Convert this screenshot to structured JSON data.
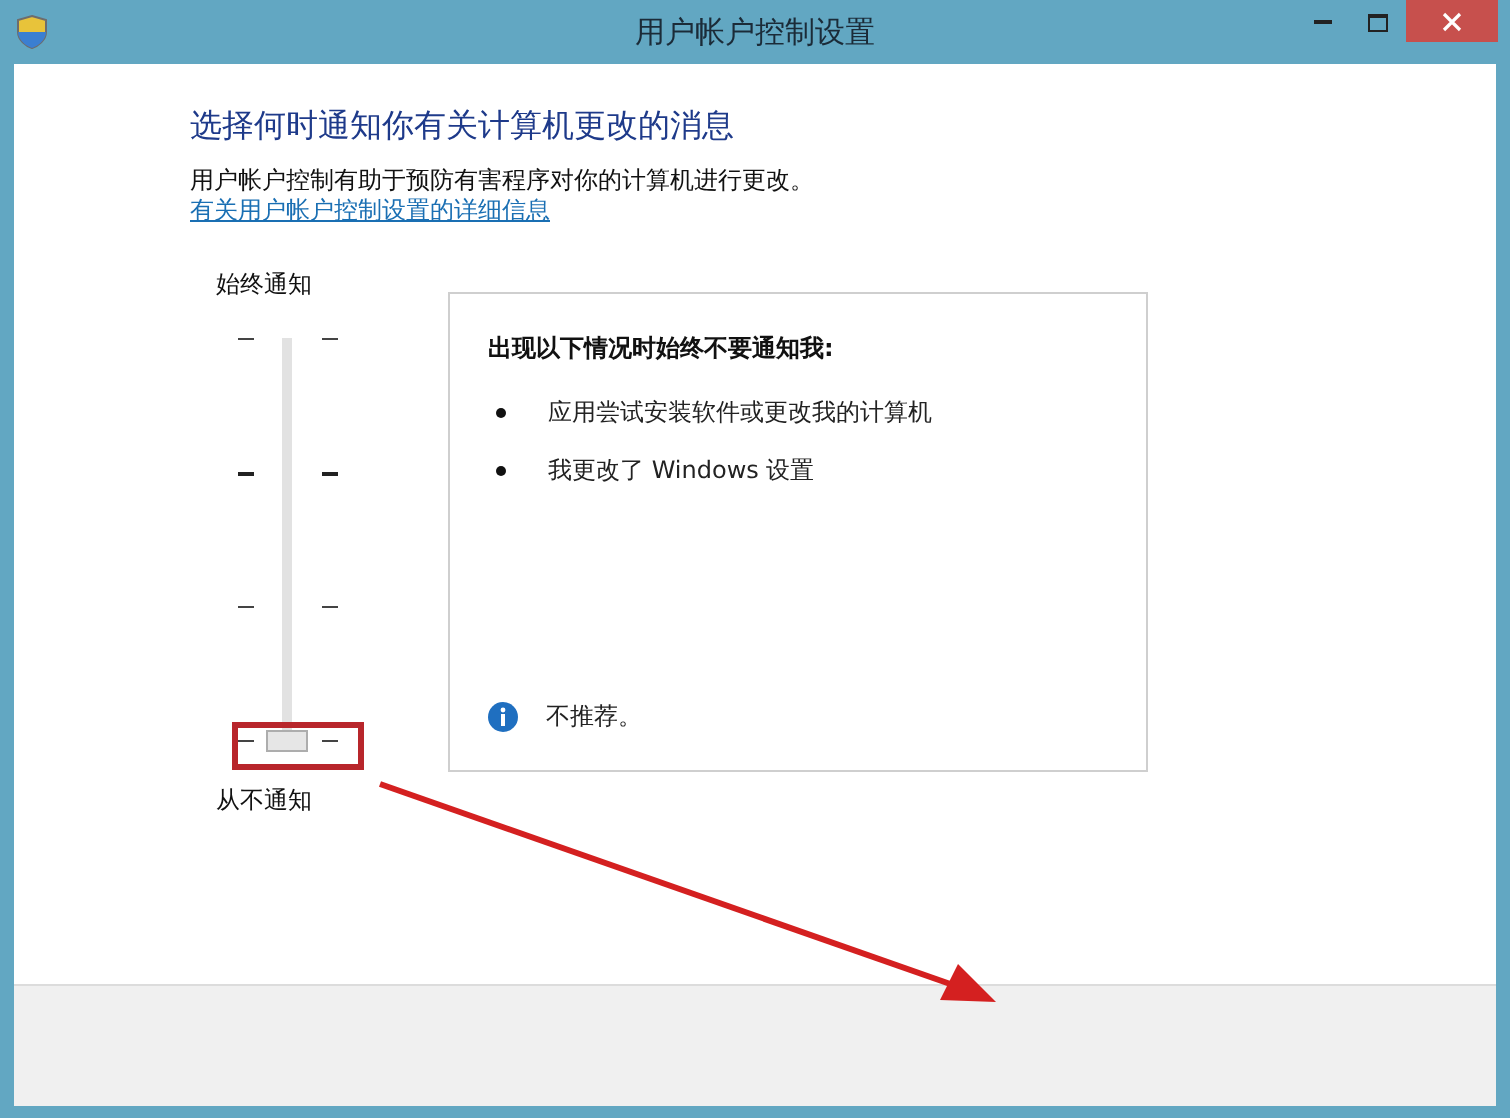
{
  "window": {
    "title": "用户帐户控制设置"
  },
  "heading": "选择何时通知你有关计算机更改的消息",
  "description": "用户帐户控制有助于预防有害程序对你的计算机进行更改。",
  "link": "有关用户帐户控制设置的详细信息",
  "slider": {
    "top_label": "始终通知",
    "bottom_label": "从不通知",
    "level": 0
  },
  "info_panel": {
    "title": "出现以下情况时始终不要通知我:",
    "bullets": [
      "应用尝试安装软件或更改我的计算机",
      "我更改了 Windows 设置"
    ],
    "note": "不推荐。"
  }
}
